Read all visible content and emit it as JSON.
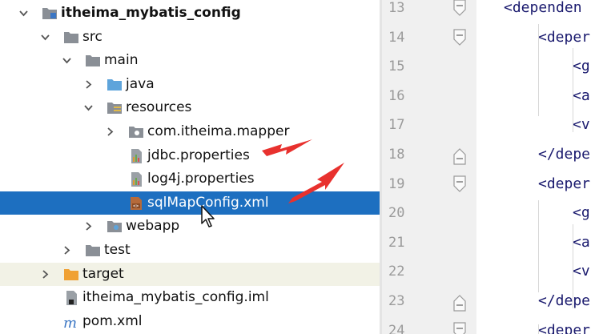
{
  "tree": {
    "rows": [
      {
        "label": "itheima_mybatis_config",
        "bold": true,
        "arrow": "down",
        "icon": "module-folder"
      },
      {
        "label": "src",
        "arrow": "down",
        "icon": "folder"
      },
      {
        "label": "main",
        "arrow": "down",
        "icon": "folder"
      },
      {
        "label": "java",
        "arrow": "right",
        "icon": "source-folder"
      },
      {
        "label": "resources",
        "arrow": "down",
        "icon": "resources-folder"
      },
      {
        "label": "com.itheima.mapper",
        "arrow": "right",
        "icon": "package-folder"
      },
      {
        "label": "jdbc.properties",
        "arrow": "none",
        "icon": "properties-file"
      },
      {
        "label": "log4j.properties",
        "arrow": "none",
        "icon": "properties-file"
      },
      {
        "label": "sqlMapConfig.xml",
        "arrow": "none",
        "icon": "xml-file",
        "selected": true
      },
      {
        "label": "webapp",
        "arrow": "right",
        "icon": "web-folder"
      },
      {
        "label": "test",
        "arrow": "right",
        "icon": "folder"
      },
      {
        "label": "target",
        "arrow": "right",
        "icon": "excluded-folder",
        "highlight": true
      },
      {
        "label": "itheima_mybatis_config.iml",
        "arrow": "none",
        "icon": "iml-file"
      },
      {
        "label": "pom.xml",
        "arrow": "none",
        "icon": "maven-file"
      }
    ]
  },
  "editor": {
    "lines": [
      {
        "num": "13",
        "code": "<dependen"
      },
      {
        "num": "14",
        "code": "<deper"
      },
      {
        "num": "15",
        "code": "<g"
      },
      {
        "num": "16",
        "code": "<a"
      },
      {
        "num": "17",
        "code": "<v"
      },
      {
        "num": "18",
        "code": "</depe"
      },
      {
        "num": "19",
        "code": "<deper"
      },
      {
        "num": "20",
        "code": "<g"
      },
      {
        "num": "21",
        "code": "<a"
      },
      {
        "num": "22",
        "code": "<v"
      },
      {
        "num": "23",
        "code": "</depe"
      },
      {
        "num": "24",
        "code": "<deper"
      }
    ]
  },
  "colors": {
    "selection": "#1d6fc0",
    "annotation": "#e8312e",
    "folder": "#8a8f96",
    "code": "#1a1a6e"
  }
}
